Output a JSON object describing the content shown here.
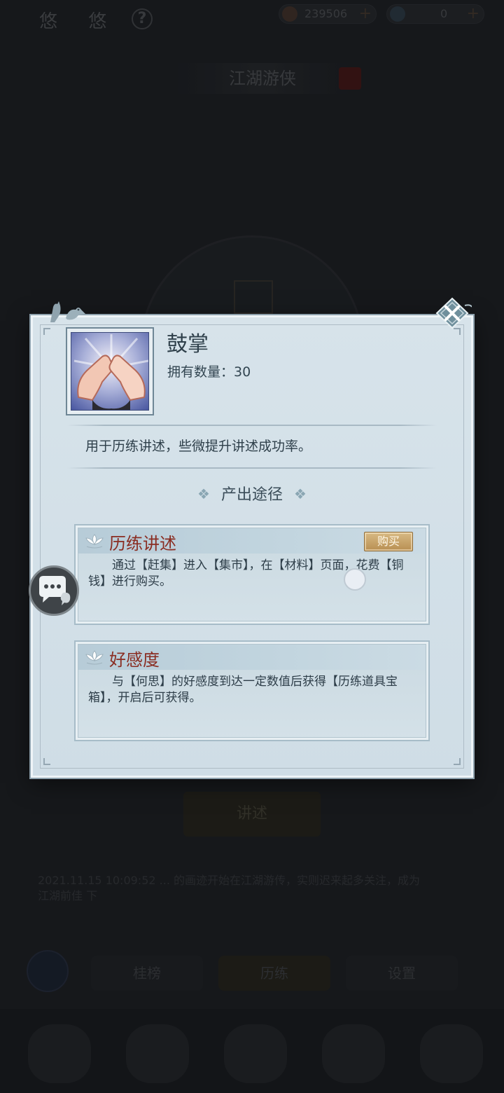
{
  "background": {
    "top_title": "悠 悠",
    "help_icon": "question-mark-icon",
    "resource_1_value": "239506",
    "resource_2_value": "0",
    "banner_title": "江湖游侠",
    "speak_button": "讲述",
    "log_text": "2021.11.15 10:09:52 ... 的画迹开始在江湖游传，实则迟来起多关注，成为江湖前佳 下",
    "nav_1": "桂榜",
    "nav_2": "历练",
    "nav_3": "设置"
  },
  "modal": {
    "item_name": "鼓掌",
    "item_count_label": "拥有数量：",
    "item_count_value": "30",
    "item_description": "用于历练讲述，些微提升讲述成功率。",
    "section_title": "产出途径",
    "sources": [
      {
        "title": "历练讲述",
        "buy_label": "购买",
        "description": "通过【赶集】进入【集市】，在【材料】页面，花费【铜钱】进行购买。"
      },
      {
        "title": "好感度",
        "description": "与【何思】的好感度到达一定数值后获得【历练道具宝箱】，开启后可获得。"
      }
    ],
    "icons": {
      "close": "close-icon",
      "item": "clapping-hands-icon",
      "decor": "birds-icon",
      "section_ornament": "diamond-ornament-icon",
      "card_ornament": "lotus-icon",
      "chat": "chat-bubble-icon"
    }
  },
  "colors": {
    "modal_bg": "#d7e3ea",
    "card_title": "#8a2d22",
    "buy_button": "#c9a56a",
    "dim_background": "#22252a"
  }
}
